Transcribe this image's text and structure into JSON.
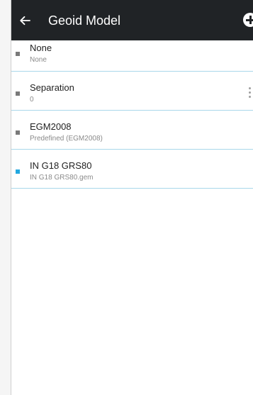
{
  "app_bar": {
    "title": "Geoid Model",
    "back_icon": "arrow-left-icon",
    "add_icon": "add-circle-icon",
    "background": "#202326"
  },
  "items": [
    {
      "title": "None",
      "subtitle": "None",
      "selected": false
    },
    {
      "title": "Separation",
      "subtitle": "0",
      "selected": false,
      "has_menu": true,
      "menu_icon": "more-vertical-icon"
    },
    {
      "title": "EGM2008",
      "subtitle": "Predefined (EGM2008)",
      "selected": false
    },
    {
      "title": "IN G18 GRS80",
      "subtitle": "IN G18 GRS80.gem",
      "selected": true
    }
  ],
  "colors": {
    "accent": "#23a8e0",
    "divider": "#a9d7ea",
    "bullet_default": "#7a7a7a"
  }
}
